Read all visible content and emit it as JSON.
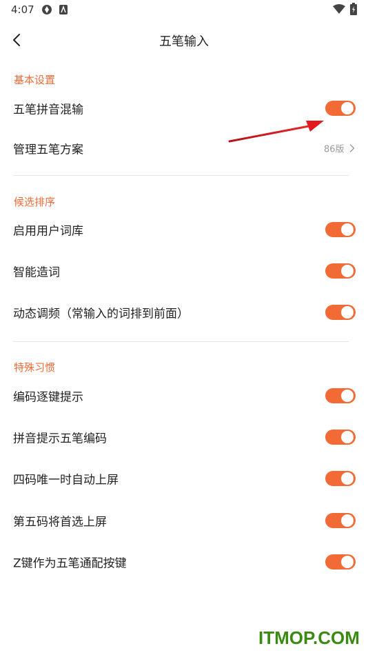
{
  "status_bar": {
    "time": "4:07"
  },
  "app_bar": {
    "title": "五笔输入",
    "back_icon": "chevron-left-icon"
  },
  "sections": {
    "basic": {
      "header": "基本设置",
      "wubi_pinyin_mix": {
        "label": "五笔拼音混输",
        "on": true
      },
      "manage_scheme": {
        "label": "管理五笔方案",
        "value": "86版"
      }
    },
    "candidate": {
      "header": "候选排序",
      "user_dict": {
        "label": "启用用户词库",
        "on": true
      },
      "smart_words": {
        "label": "智能造词",
        "on": true
      },
      "dynamic_freq": {
        "label": "动态调频（常输入的词排到前面）",
        "on": true
      }
    },
    "habits": {
      "header": "特殊习惯",
      "code_hint": {
        "label": "编码逐键提示",
        "on": true
      },
      "pinyin_hint": {
        "label": "拼音提示五笔编码",
        "on": true
      },
      "four_code_auto": {
        "label": "四码唯一时自动上屏",
        "on": true
      },
      "fifth_code": {
        "label": "第五码将首选上屏",
        "on": true
      },
      "z_key": {
        "label": "Z键作为五笔通配按键",
        "on": true
      }
    }
  },
  "colors": {
    "accent": "#f26a35",
    "section_header": "#ee6b38",
    "annotation_arrow": "#d8161b",
    "watermark": "#3a8a14"
  },
  "watermark": {
    "text": "ITMOP.COM"
  }
}
